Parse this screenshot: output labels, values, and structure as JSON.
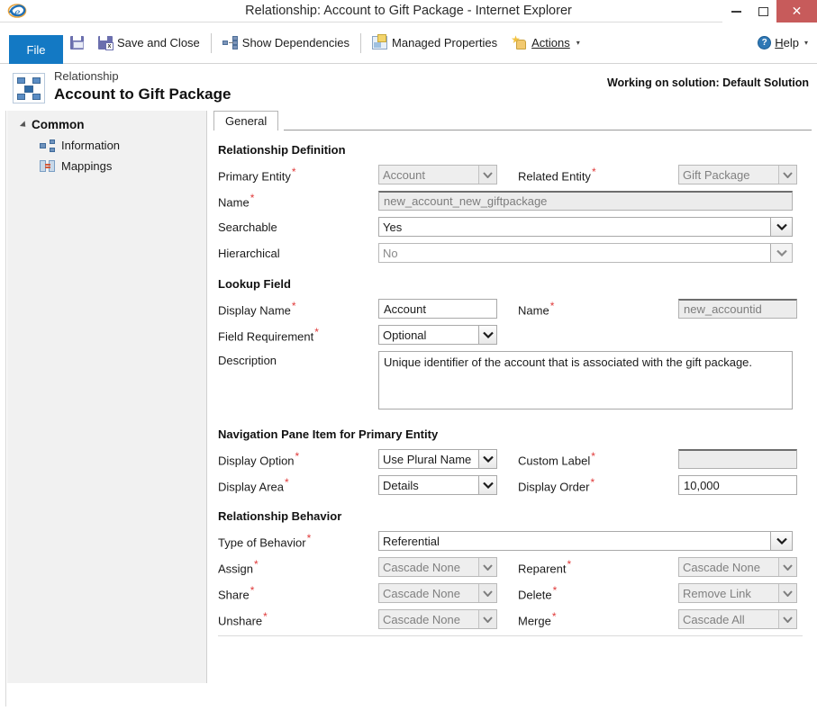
{
  "window": {
    "title": "Relationship: Account to Gift Package - Internet Explorer",
    "logo_icon": "internet-explorer-logo",
    "minimize_label": "Minimize",
    "maximize_label": "Maximize",
    "close_label": "✕"
  },
  "ribbon": {
    "file_label": "File",
    "save_icon": "save-icon",
    "save_and_close_icon": "save-and-close-icon",
    "save_and_close_label": "Save and Close",
    "dependencies_icon": "show-dependencies-icon",
    "dependencies_label": "Show Dependencies",
    "managed_properties_icon": "managed-properties-icon",
    "managed_properties_label": "Managed Properties",
    "actions_icon": "actions-icon",
    "actions_label": "Actions",
    "actions_caret": "▾",
    "help_icon": "help-icon",
    "help_label_pre": "H",
    "help_label_rest": "elp",
    "help_caret": "▾"
  },
  "header": {
    "entity_icon": "relationship-icon",
    "subtitle": "Relationship",
    "title": "Account to Gift Package",
    "solution_note": "Working on solution: Default Solution"
  },
  "sidebar": {
    "group_label": "Common",
    "items": [
      {
        "label": "Information",
        "icon": "information-icon"
      },
      {
        "label": "Mappings",
        "icon": "mappings-icon"
      }
    ]
  },
  "tabs": [
    {
      "label": "General",
      "active": true
    }
  ],
  "sections": {
    "relationship_definition": {
      "title": "Relationship Definition",
      "primary_entity": {
        "label": "Primary Entity",
        "required": "*",
        "value": "Account",
        "disabled": true
      },
      "related_entity": {
        "label": "Related Entity",
        "required": "*",
        "value": "Gift Package",
        "disabled": true
      },
      "name": {
        "label": "Name",
        "required": "*",
        "value": "new_account_new_giftpackage",
        "disabled": true
      },
      "searchable": {
        "label": "Searchable",
        "required": "",
        "value": "Yes",
        "disabled": false
      },
      "hierarchical": {
        "label": "Hierarchical",
        "required": "",
        "value": "No",
        "disabled": true
      }
    },
    "lookup_field": {
      "title": "Lookup Field",
      "display_name": {
        "label": "Display Name",
        "required": "*",
        "value": "Account",
        "disabled": false
      },
      "name": {
        "label": "Name",
        "required": "*",
        "value": "new_accountid",
        "disabled": true
      },
      "field_requirement": {
        "label": "Field Requirement",
        "required": "*",
        "value": "Optional",
        "disabled": false
      },
      "description": {
        "label": "Description",
        "required": "",
        "value": "Unique identifier of the account that is associated with the gift package.",
        "disabled": false
      }
    },
    "navigation_pane": {
      "title": "Navigation Pane Item for Primary Entity",
      "display_option": {
        "label": "Display Option",
        "required": "*",
        "value": "Use Plural Name",
        "disabled": false
      },
      "custom_label": {
        "label": "Custom Label",
        "required": "*",
        "value": "",
        "disabled": true
      },
      "display_area": {
        "label": "Display Area",
        "required": "*",
        "value": "Details",
        "disabled": false
      },
      "display_order": {
        "label": "Display Order",
        "required": "*",
        "value": "10,000",
        "disabled": false
      }
    },
    "relationship_behavior": {
      "title": "Relationship Behavior",
      "type_of_behavior": {
        "label": "Type of Behavior",
        "required": "*",
        "value": "Referential",
        "disabled": false
      },
      "assign": {
        "label": "Assign",
        "required": "*",
        "value": "Cascade None",
        "disabled": true
      },
      "reparent": {
        "label": "Reparent",
        "required": "*",
        "value": "Cascade None",
        "disabled": true
      },
      "share": {
        "label": "Share",
        "required": "*",
        "value": "Cascade None",
        "disabled": true
      },
      "delete": {
        "label": "Delete",
        "required": "*",
        "value": "Remove Link",
        "disabled": true
      },
      "unshare": {
        "label": "Unshare",
        "required": "*",
        "value": "Cascade None",
        "disabled": true
      },
      "merge": {
        "label": "Merge",
        "required": "*",
        "value": "Cascade All",
        "disabled": true
      }
    }
  },
  "colors": {
    "file_button": "#1379c4",
    "close_button": "#c75b5b",
    "required_marker": "#e03a3a",
    "sidebar_bg": "#f1f1f1"
  }
}
